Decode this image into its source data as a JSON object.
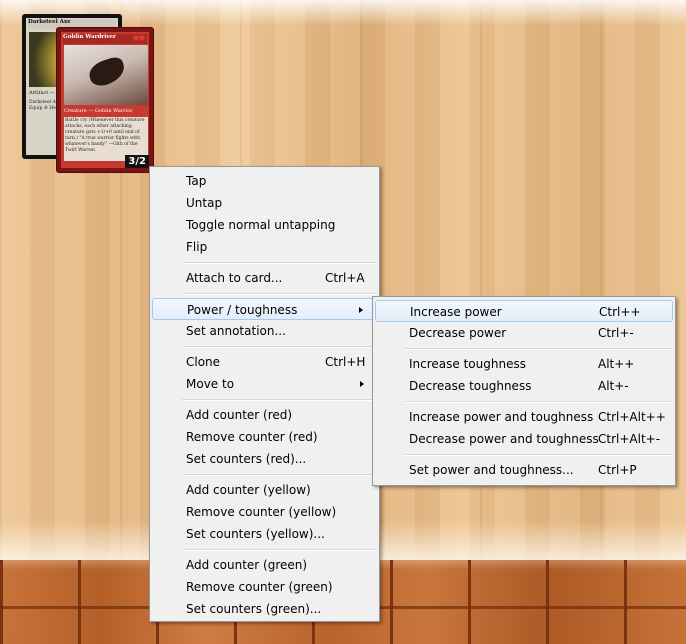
{
  "cards": {
    "darksteel_axe": {
      "title": "Darksteel Axe",
      "type": "Artifact — E",
      "text": "Darksteel A that say \"d Equipped c Equip ⑧ Heavier than seemed to it"
    },
    "goblin_wardriver": {
      "title": "Goblin Wardriver",
      "type": "Creature — Goblin Warrior",
      "text": "Battle cry (Whenever this creature attacks, each other attacking creature gets +1/+0 until end of turn.) \"A true warrior fights with whatever's handy\" —Gith of the Twirl Warren",
      "power_toughness": "3/2"
    }
  },
  "context_menu": {
    "items": [
      {
        "label": "Tap"
      },
      {
        "label": "Untap"
      },
      {
        "label": "Toggle normal untapping"
      },
      {
        "label": "Flip"
      },
      {
        "label": "Attach to card...",
        "shortcut": "Ctrl+A"
      },
      {
        "label": "Power / toughness",
        "submenu": true,
        "highlighted": true
      },
      {
        "label": "Set annotation..."
      },
      {
        "label": "Clone",
        "shortcut": "Ctrl+H"
      },
      {
        "label": "Move to",
        "submenu": true
      },
      {
        "label": "Add counter (red)"
      },
      {
        "label": "Remove counter (red)"
      },
      {
        "label": "Set counters (red)..."
      },
      {
        "label": "Add counter (yellow)"
      },
      {
        "label": "Remove counter (yellow)"
      },
      {
        "label": "Set counters (yellow)..."
      },
      {
        "label": "Add counter (green)"
      },
      {
        "label": "Remove counter (green)"
      },
      {
        "label": "Set counters (green)..."
      }
    ]
  },
  "power_menu": {
    "items": [
      {
        "label": "Increase power",
        "shortcut": "Ctrl++",
        "highlighted": true
      },
      {
        "label": "Decrease power",
        "shortcut": "Ctrl+-"
      },
      {
        "label": "Increase toughness",
        "shortcut": "Alt++"
      },
      {
        "label": "Decrease toughness",
        "shortcut": "Alt+-"
      },
      {
        "label": "Increase power and toughness",
        "shortcut": "Ctrl+Alt++"
      },
      {
        "label": "Decrease power and toughness",
        "shortcut": "Ctrl+Alt+-"
      },
      {
        "label": "Set power and toughness...",
        "shortcut": "Ctrl+P"
      }
    ]
  }
}
